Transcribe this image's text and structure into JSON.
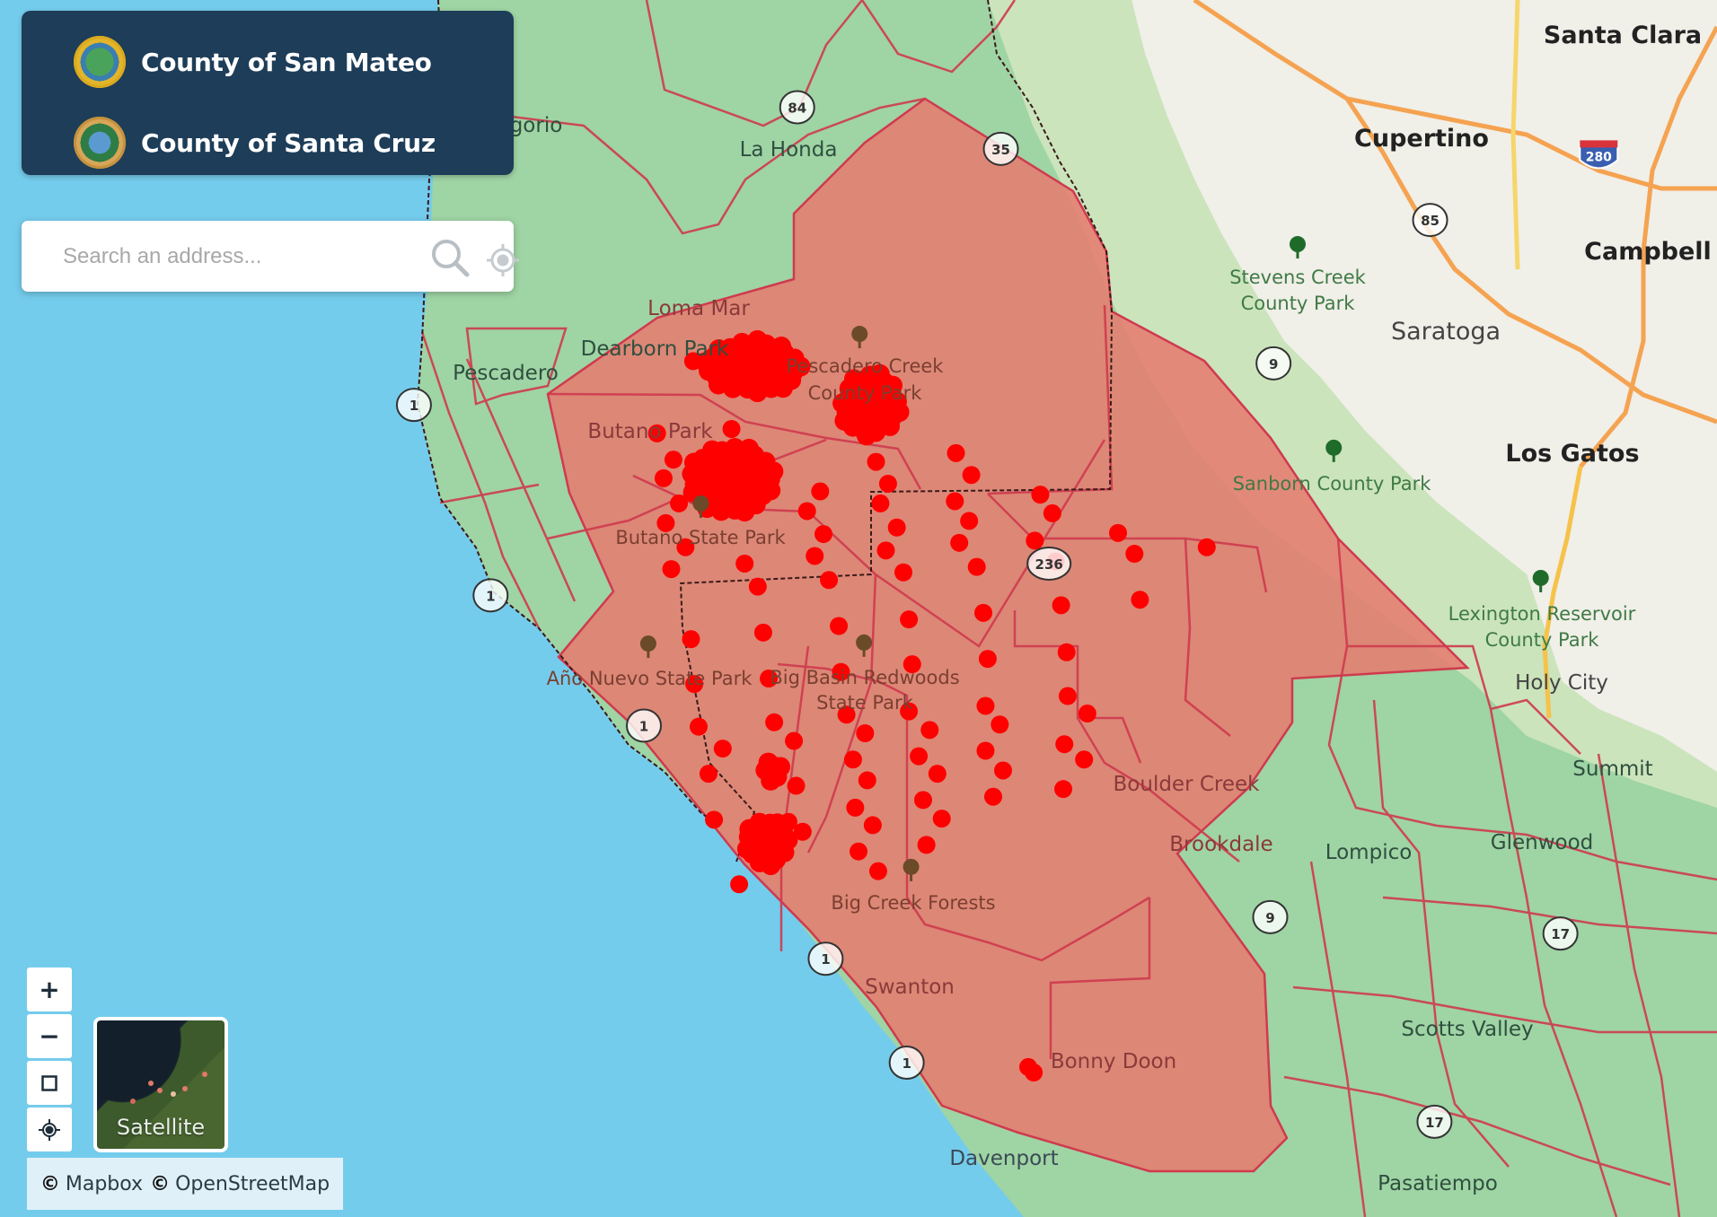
{
  "counties": [
    {
      "name": "County of San Mateo",
      "seal_icon": "san-mateo-seal"
    },
    {
      "name": "County of Santa Cruz",
      "seal_icon": "santa-cruz-seal"
    }
  ],
  "search": {
    "placeholder": "Search an address...",
    "value": "",
    "search_icon": "magnifier-icon",
    "locate_icon": "crosshair-locate-icon"
  },
  "map_controls": {
    "zoom_in": "+",
    "zoom_out": "−",
    "select_box": "□",
    "locate": "⌖"
  },
  "basemap_toggle": {
    "label": "Satellite"
  },
  "attribution": {
    "copyright_symbol": "©",
    "items": [
      "Mapbox",
      "OpenStreetMap"
    ]
  },
  "colors": {
    "panel_bg": "#1d3d58",
    "ocean": "#74ccec",
    "land_green": "#9fd4a4",
    "urban": "#f1efe7",
    "fire_zone": "#e98a7c",
    "fire_zone_border": "#cf3a4e",
    "incident_dot": "#ff0000",
    "highway": "#f5a351"
  },
  "map_labels": {
    "cities": [
      {
        "name": "Santa Clara"
      },
      {
        "name": "Cupertino"
      },
      {
        "name": "Campbell"
      },
      {
        "name": "Saratoga"
      },
      {
        "name": "Los Gatos"
      },
      {
        "name": "Holy City"
      }
    ],
    "towns": [
      {
        "name": "La Honda"
      },
      {
        "name": "gorio"
      },
      {
        "name": "Loma Mar"
      },
      {
        "name": "Dearborn Park"
      },
      {
        "name": "Pescadero"
      },
      {
        "name": "Butano Park"
      },
      {
        "name": "Boulder Creek"
      },
      {
        "name": "Brookdale"
      },
      {
        "name": "Swanton"
      },
      {
        "name": "Bonny Doon"
      },
      {
        "name": "Davenport"
      },
      {
        "name": "Lompico"
      },
      {
        "name": "Scotts Valley"
      },
      {
        "name": "Glenwood"
      },
      {
        "name": "Summit"
      },
      {
        "name": "Pasatiempo"
      }
    ],
    "parks": [
      {
        "name": "Stevens Creek",
        "line2": "County Park"
      },
      {
        "name": "Sanborn County Park"
      },
      {
        "name": "Lexington Reservoir",
        "line2": "County Park"
      },
      {
        "name": "Pescadero Creek",
        "line2": "County Park"
      },
      {
        "name": "Butano State Park"
      },
      {
        "name": "Año Nuevo State Park"
      },
      {
        "name": "Big Basin Redwoods",
        "line2": "State Park"
      },
      {
        "name": "Big Creek Forests"
      }
    ],
    "highway_shields": [
      {
        "route": "280",
        "type": "interstate"
      },
      {
        "route": "85",
        "type": "state"
      },
      {
        "route": "9",
        "type": "state"
      },
      {
        "route": "84",
        "type": "state"
      },
      {
        "route": "35",
        "type": "state"
      },
      {
        "route": "236",
        "type": "state"
      },
      {
        "route": "1",
        "type": "state"
      },
      {
        "route": "1",
        "type": "state"
      },
      {
        "route": "1",
        "type": "state"
      },
      {
        "route": "1",
        "type": "state"
      },
      {
        "route": "1",
        "type": "state"
      },
      {
        "route": "9",
        "type": "state"
      },
      {
        "route": "17",
        "type": "state"
      },
      {
        "route": "17",
        "type": "state"
      }
    ]
  }
}
